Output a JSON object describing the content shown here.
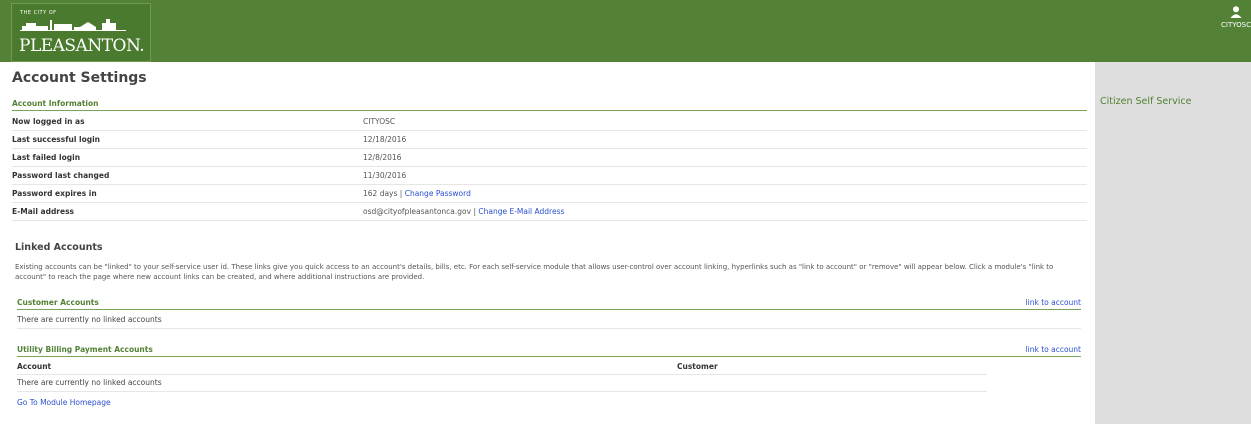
{
  "header": {
    "logo_top": "THE CITY OF",
    "logo_name": "PLEASANTON.",
    "username": "CITYOSC"
  },
  "page": {
    "title": "Account Settings"
  },
  "account_info": {
    "heading": "Account Information",
    "rows": [
      {
        "label": "Now logged in as",
        "value": "CITYOSC"
      },
      {
        "label": "Last successful login",
        "value": "12/18/2016"
      },
      {
        "label": "Last failed login",
        "value": "12/8/2016"
      },
      {
        "label": "Password last changed",
        "value": "11/30/2016"
      },
      {
        "label": "Password expires in",
        "value": "162 days |",
        "link": "Change Password"
      },
      {
        "label": "E-Mail address",
        "value": "osd@cityofpleasantonca.gov |",
        "link": "Change E-Mail Address"
      }
    ]
  },
  "linked": {
    "title": "Linked Accounts",
    "description": "Existing accounts can be \"linked\" to your self-service user id. These links give you quick access to an account's details, bills, etc. For each self-service module that allows user-control over account linking, hyperlinks such as \"link to account\" or \"remove\" will appear below. Click a module's \"link to account\" to reach the page where new account links can be created, and where additional instructions are provided.",
    "customer": {
      "heading": "Customer Accounts",
      "link": "link to account",
      "empty": "There are currently no linked accounts"
    },
    "utility": {
      "heading": "Utility Billing Payment Accounts",
      "link": "link to account",
      "col_account": "Account",
      "col_customer": "Customer",
      "empty": "There are currently no linked accounts"
    },
    "home_link": "Go To Module Homepage"
  },
  "sidebar": {
    "link": "Citizen Self Service"
  },
  "icons": {
    "user": "user-icon"
  },
  "colors": {
    "brand_green": "#538135",
    "link_blue": "#2b4fd0",
    "sidebar_gray": "#dedede"
  }
}
